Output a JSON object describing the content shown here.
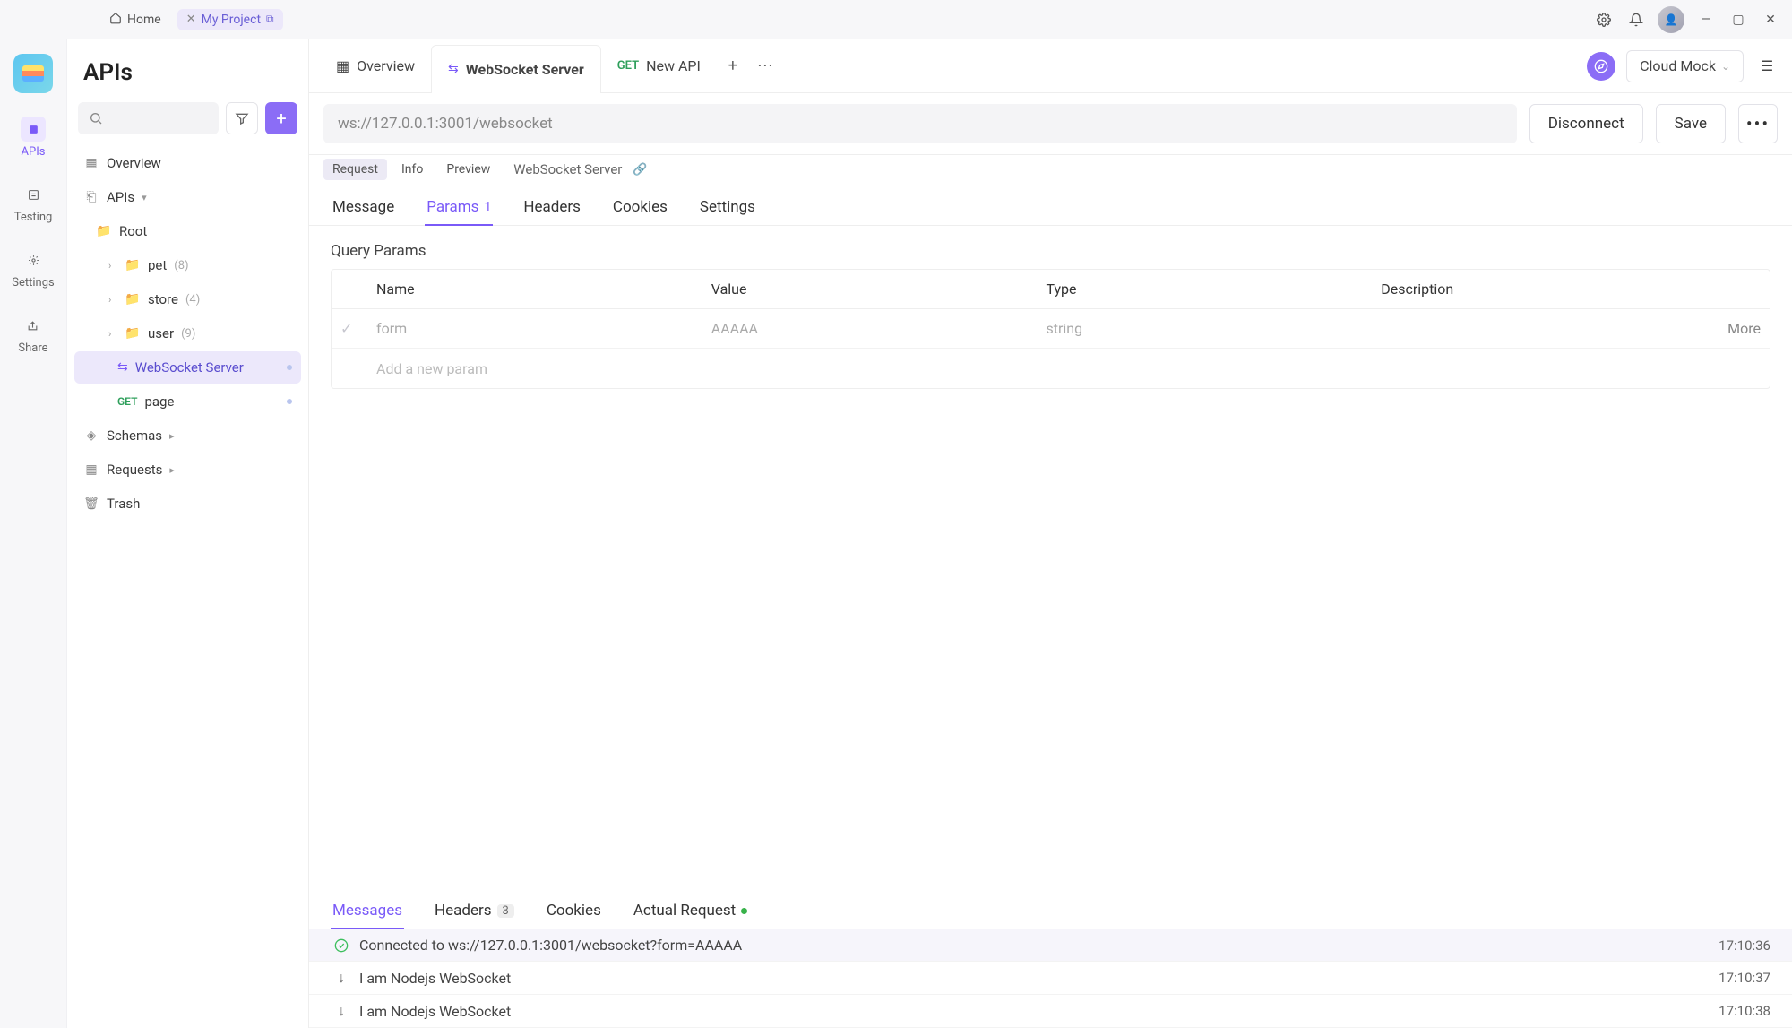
{
  "titlebar": {
    "home": "Home",
    "project": "My Project"
  },
  "nav": {
    "apis": "APIs",
    "testing": "Testing",
    "settings": "Settings",
    "share": "Share"
  },
  "sidebar": {
    "title": "APIs",
    "overview": "Overview",
    "apis_label": "APIs",
    "root": "Root",
    "pet": "pet",
    "pet_count": "(8)",
    "store": "store",
    "store_count": "(4)",
    "user": "user",
    "user_count": "(9)",
    "ws_server": "WebSocket Server",
    "page_method": "GET",
    "page_label": "page",
    "schemas": "Schemas",
    "requests": "Requests",
    "trash": "Trash"
  },
  "tabs": {
    "overview": "Overview",
    "ws": "WebSocket Server",
    "newapi_method": "GET",
    "newapi_label": "New API",
    "cloud_mock": "Cloud Mock"
  },
  "url": {
    "value": "ws://127.0.0.1:3001/websocket",
    "disconnect": "Disconnect",
    "save": "Save"
  },
  "subtabs": {
    "request": "Request",
    "info": "Info",
    "preview": "Preview",
    "ws_name": "WebSocket Server"
  },
  "sectiontabs": {
    "message": "Message",
    "params": "Params",
    "params_count": "1",
    "headers": "Headers",
    "cookies": "Cookies",
    "settings": "Settings"
  },
  "params": {
    "title": "Query Params",
    "col_name": "Name",
    "col_value": "Value",
    "col_type": "Type",
    "col_desc": "Description",
    "row1": {
      "name": "form",
      "value": "AAAAA",
      "type": "string",
      "desc": ""
    },
    "more": "More",
    "add_placeholder": "Add a new param"
  },
  "bottom": {
    "messages": "Messages",
    "headers": "Headers",
    "headers_count": "3",
    "cookies": "Cookies",
    "actual": "Actual Request",
    "rows": [
      {
        "text": "Connected to ws://127.0.0.1:3001/websocket?form=AAAAA",
        "time": "17:10:36",
        "kind": "ok"
      },
      {
        "text": "I am Nodejs WebSocket",
        "time": "17:10:37",
        "kind": "in"
      },
      {
        "text": "I am Nodejs WebSocket",
        "time": "17:10:38",
        "kind": "in"
      }
    ]
  }
}
